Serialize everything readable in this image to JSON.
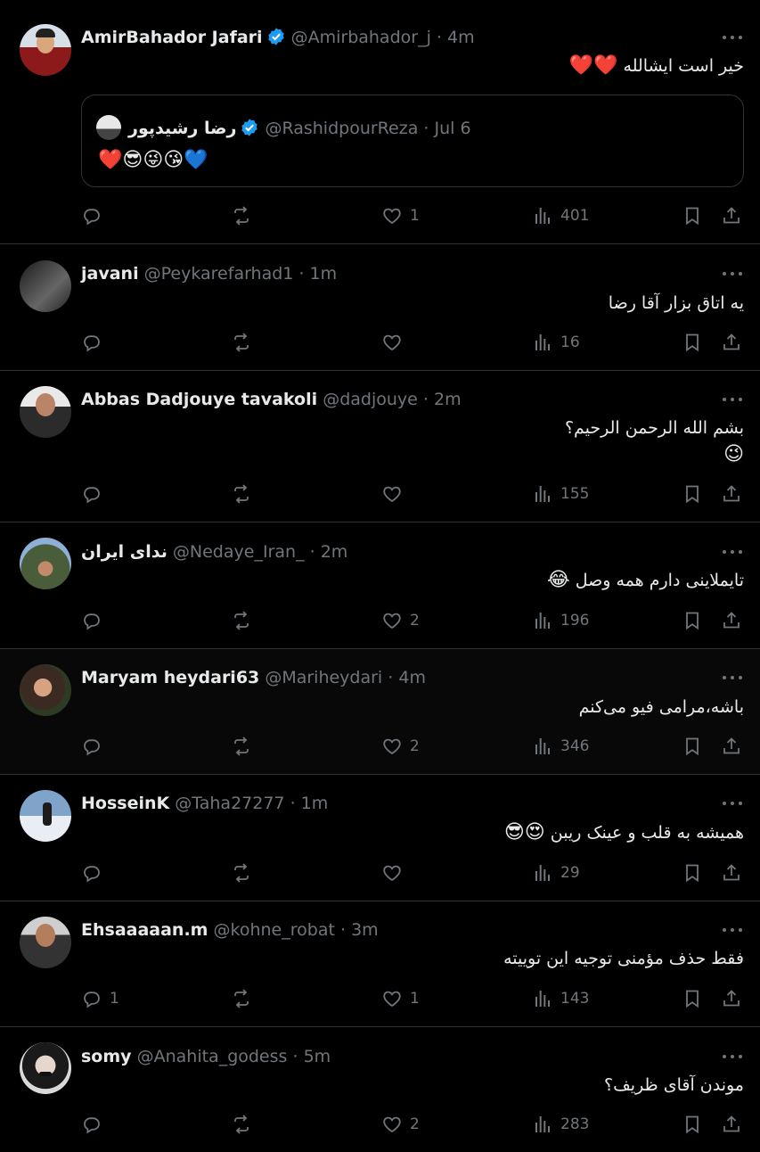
{
  "tweets": [
    {
      "name": "AmirBahador Jafari",
      "verified": true,
      "handle": "@Amirbahador_j",
      "time": "4m",
      "text": "خیر است ایشالله",
      "text_emoji": "❤️❤️",
      "quote": {
        "name": "رضا رشیدپور",
        "verified": true,
        "handle": "@RashidpourReza",
        "time": "Jul 6",
        "text": "❤️😎😜😘💙"
      },
      "replies": "",
      "likes": "1",
      "views": "401"
    },
    {
      "name": "javani",
      "handle": "@Peykarefarhad1",
      "time": "1m",
      "text": "یه اتاق بزار آقا رضا",
      "replies": "",
      "likes": "",
      "views": "16"
    },
    {
      "name": "Abbas Dadjouye tavakoli",
      "handle": "@dadjouye",
      "time": "2m",
      "text": "بشم الله الرحمن الرحیم؟",
      "text_line2": "😉",
      "replies": "",
      "likes": "",
      "views": "155"
    },
    {
      "name": "ندای ایران",
      "handle": "@Nedaye_Iran_",
      "time": "2m",
      "text": "تایملاینی دارم همه وصل",
      "text_emoji": "😂",
      "replies": "",
      "likes": "2",
      "views": "196"
    },
    {
      "name": "Maryam heydari63",
      "handle": "@Mariheydari",
      "time": "4m",
      "text": "باشه،مرامی فیو می‌کنم",
      "replies": "",
      "likes": "2",
      "views": "346"
    },
    {
      "name": "HosseinK",
      "handle": "@Taha27277",
      "time": "1m",
      "text": "همیشه به قلب و عینک ریبن",
      "text_emoji": "😍😎",
      "replies": "",
      "likes": "",
      "views": "29"
    },
    {
      "name": "Ehsaaaaan.m",
      "handle": "@kohne_robat",
      "time": "3m",
      "text": "فقط حذف مؤمنی توجیه این توییته",
      "replies": "1",
      "likes": "1",
      "views": "143"
    },
    {
      "name": "somy",
      "handle": "@Anahita_godess",
      "time": "5m",
      "text": "موندن آقای ظریف؟",
      "replies": "",
      "likes": "2",
      "views": "283"
    }
  ],
  "icons": {
    "reply": "reply-icon",
    "retweet": "retweet-icon",
    "like": "like-icon",
    "views": "views-icon",
    "bookmark": "bookmark-icon",
    "share": "share-icon",
    "more": "more-icon",
    "verified": "verified-badge-icon"
  },
  "colors": {
    "background": "#000000",
    "highlight_background": "#080808",
    "divider": "#2f3336",
    "text": "#e7e9ea",
    "secondary": "#71767b",
    "verified": "#1d9bf0"
  },
  "separator": "·"
}
